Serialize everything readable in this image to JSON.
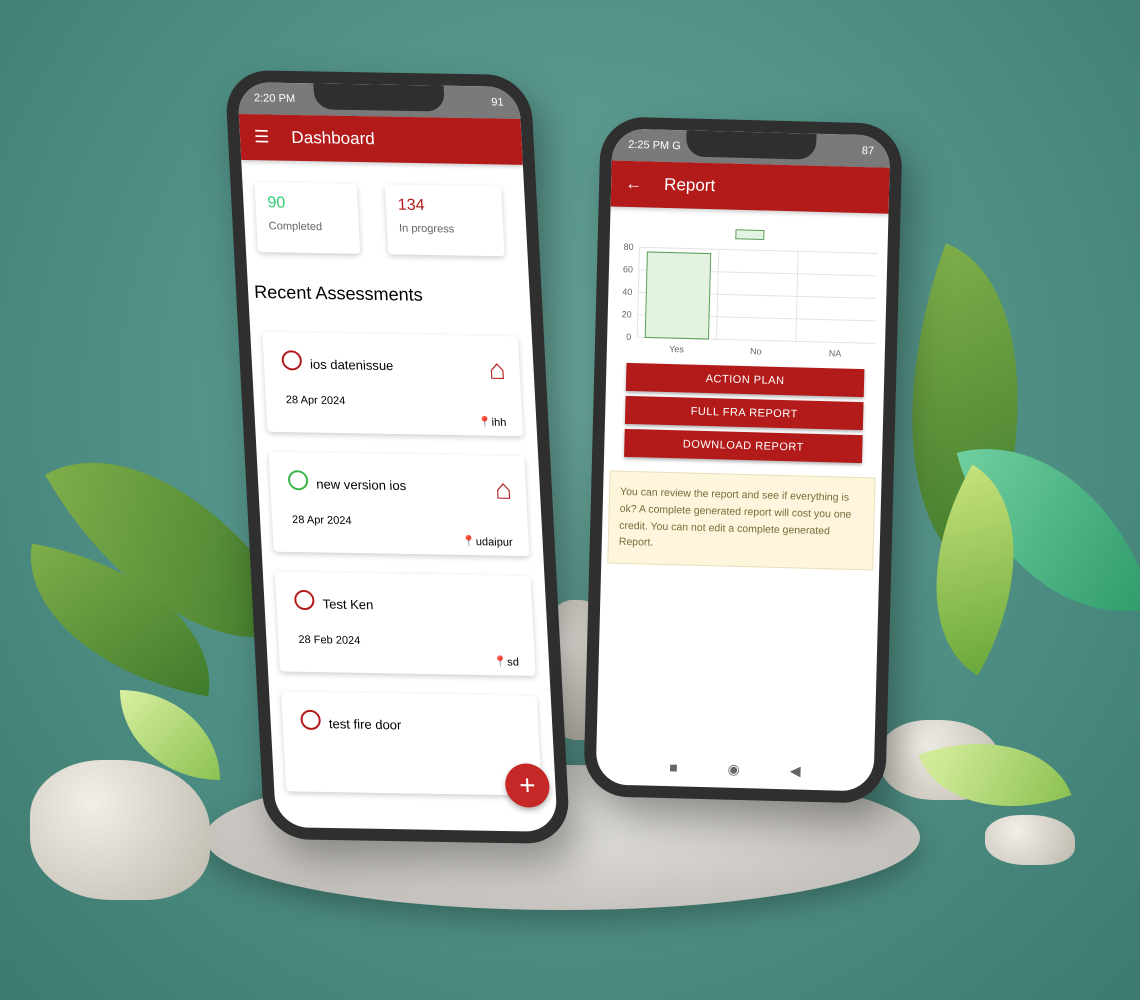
{
  "dashboard": {
    "status_time": "2:20 PM",
    "battery": "91",
    "title": "Dashboard",
    "completed": {
      "count": "90",
      "label": "Completed"
    },
    "in_progress": {
      "count": "134",
      "label": "In progress"
    },
    "section_title": "Recent Assessments",
    "assessments": [
      {
        "title": "ios datenissue",
        "date": "28 Apr 2024",
        "location": "ihh",
        "status": "pending"
      },
      {
        "title": "new version ios",
        "date": "28 Apr 2024",
        "location": "udaipur",
        "status": "completed"
      },
      {
        "title": "Test Ken",
        "date": "28 Feb 2024",
        "location": "sd",
        "status": "pending"
      },
      {
        "title": "test fire door",
        "date": "",
        "location": "",
        "status": "pending"
      }
    ],
    "fab": "+"
  },
  "report": {
    "status_time": "2:25 PM G",
    "battery": "87",
    "title": "Report",
    "buttons": [
      "ACTION PLAN",
      "FULL FRA REPORT",
      "DOWNLOAD REPORT"
    ],
    "notice": "You can review the report and see if everything is ok? A complete generated report will cost you one credit. You can not edit a complete generated Report."
  },
  "chart_data": {
    "type": "bar",
    "categories": [
      "Yes",
      "No",
      "NA"
    ],
    "values": [
      76,
      0,
      0
    ],
    "yticks": [
      0,
      20,
      40,
      60,
      80
    ],
    "ylim": [
      0,
      80
    ],
    "grid": true,
    "colors": {
      "fill": "#e3f2e1",
      "stroke": "#5a9e5a"
    },
    "legend": "top-center"
  }
}
